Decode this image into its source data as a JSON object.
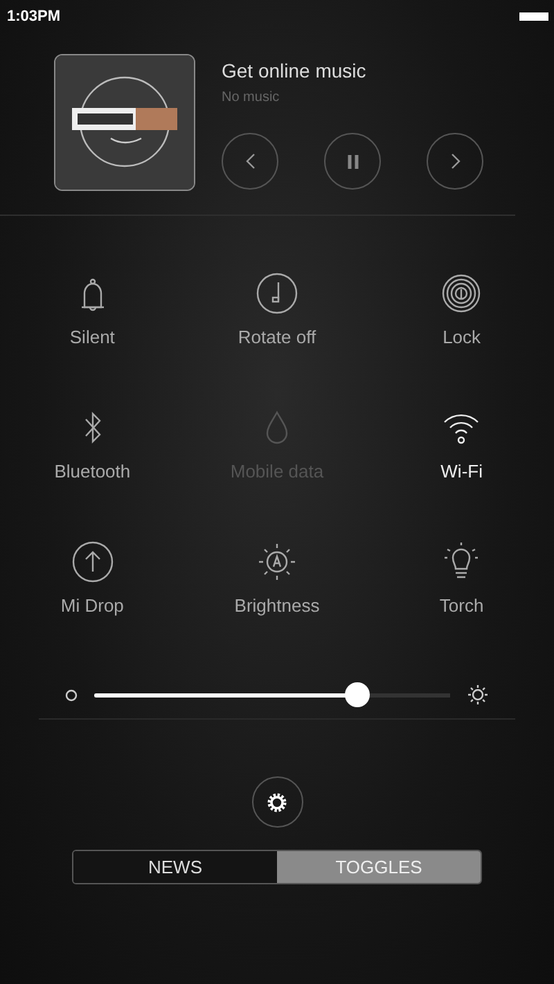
{
  "status_bar": {
    "time": "1:03PM"
  },
  "media": {
    "title": "Get online music",
    "subtitle": "No music"
  },
  "toggles": [
    {
      "label": "Silent",
      "on": false,
      "disabled": false
    },
    {
      "label": "Rotate off",
      "on": false,
      "disabled": false
    },
    {
      "label": "Lock",
      "on": false,
      "disabled": false
    },
    {
      "label": "Bluetooth",
      "on": false,
      "disabled": false
    },
    {
      "label": "Mobile data",
      "on": false,
      "disabled": true
    },
    {
      "label": "Wi-Fi",
      "on": true,
      "disabled": false
    },
    {
      "label": "Mi Drop",
      "on": false,
      "disabled": false
    },
    {
      "label": "Brightness",
      "on": false,
      "disabled": false
    },
    {
      "label": "Torch",
      "on": false,
      "disabled": false
    }
  ],
  "brightness": {
    "level": 0.74
  },
  "tabs": [
    {
      "label": "NEWS",
      "selected": false
    },
    {
      "label": "TOGGLES",
      "selected": true
    }
  ]
}
